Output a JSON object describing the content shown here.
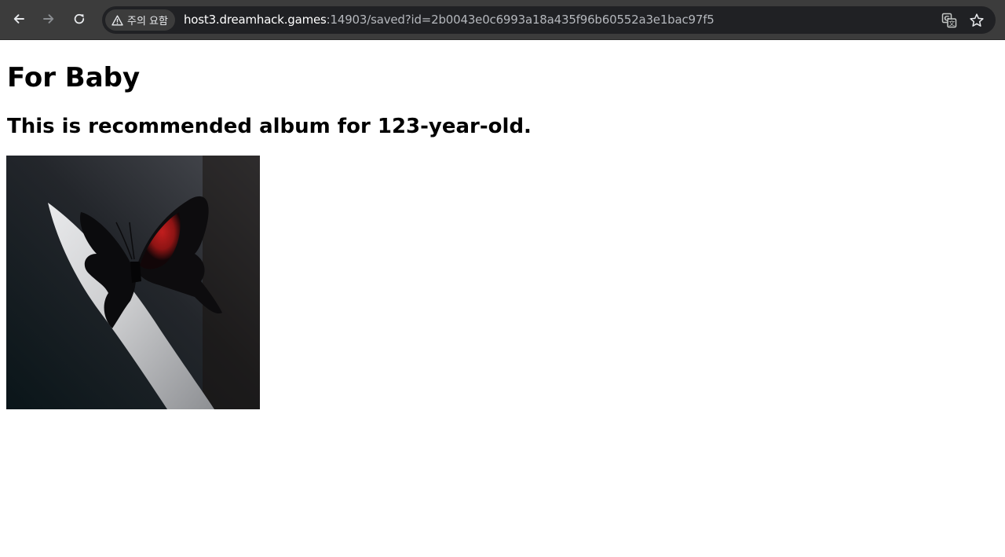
{
  "browser": {
    "back_icon": "back-arrow-icon",
    "forward_icon": "forward-arrow-icon",
    "reload_icon": "reload-icon",
    "security_label": "주의 요함",
    "security_icon": "warning-triangle-icon",
    "url_host": "host3.dreamhack.games",
    "url_rest": ":14903/saved?id=2b0043e0c6993a18a435f96b60552a3e1bac97f5",
    "translate_icon": "translate-icon",
    "bookmark_icon": "star-icon"
  },
  "page": {
    "title": "For Baby",
    "subtitle": "This is recommended album for 123-year-old.",
    "album_image": "album-cover-butterfly-image"
  },
  "colors": {
    "toolbar_bg": "#3c3c3c",
    "omnibox_bg": "#202124",
    "butterfly_red": "#b01a1a"
  }
}
